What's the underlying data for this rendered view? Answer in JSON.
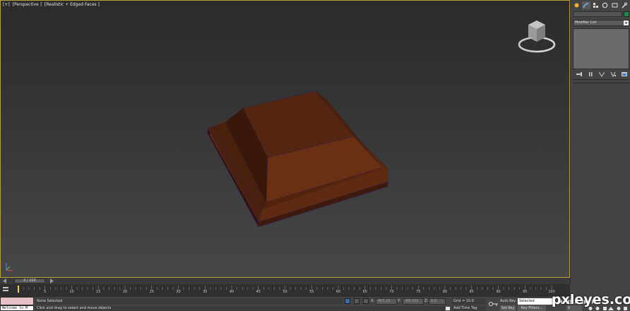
{
  "viewport": {
    "labels": [
      "[+]",
      "[Perspective ]",
      "[Realistic + Edged Faces ]"
    ]
  },
  "command_panel": {
    "tabs": [
      "create-tab",
      "modify-tab",
      "hierarchy-tab",
      "motion-tab",
      "display-tab",
      "utilities-tab"
    ],
    "active_tab": "modify-tab",
    "object_color": "#1e8a4c",
    "modifier_list_label": "Modifier List"
  },
  "time_slider": {
    "current": 0,
    "end": 100,
    "label": "0 / 100"
  },
  "trackbar": {
    "ticks": [
      "0",
      "5",
      "10",
      "15",
      "20",
      "25",
      "30",
      "35",
      "40",
      "45",
      "50",
      "55",
      "60",
      "65",
      "70",
      "75",
      "80",
      "85",
      "90",
      "95",
      "100"
    ]
  },
  "status": {
    "listener_text": "Welcome to M",
    "selection": "None Selected",
    "prompt": "Click and drag to select and move objects",
    "x_label": "X:",
    "x_value": "407.21",
    "y_label": "Y:",
    "y_value": "-69.722",
    "z_label": "Z:",
    "z_value": "0.0",
    "grid": "Grid = 10.0",
    "add_time_tag": "Add Time Tag",
    "auto_key": "Auto Key",
    "set_key": "Set Key",
    "selected_option": "Selected",
    "key_filters": "Key Filters...",
    "frame": "0"
  },
  "watermark": "pxleyes.com",
  "colors": {
    "object": "#5e2a10",
    "viewport_border": "#b99f3a",
    "listener_bg": "#e7c1c6"
  }
}
